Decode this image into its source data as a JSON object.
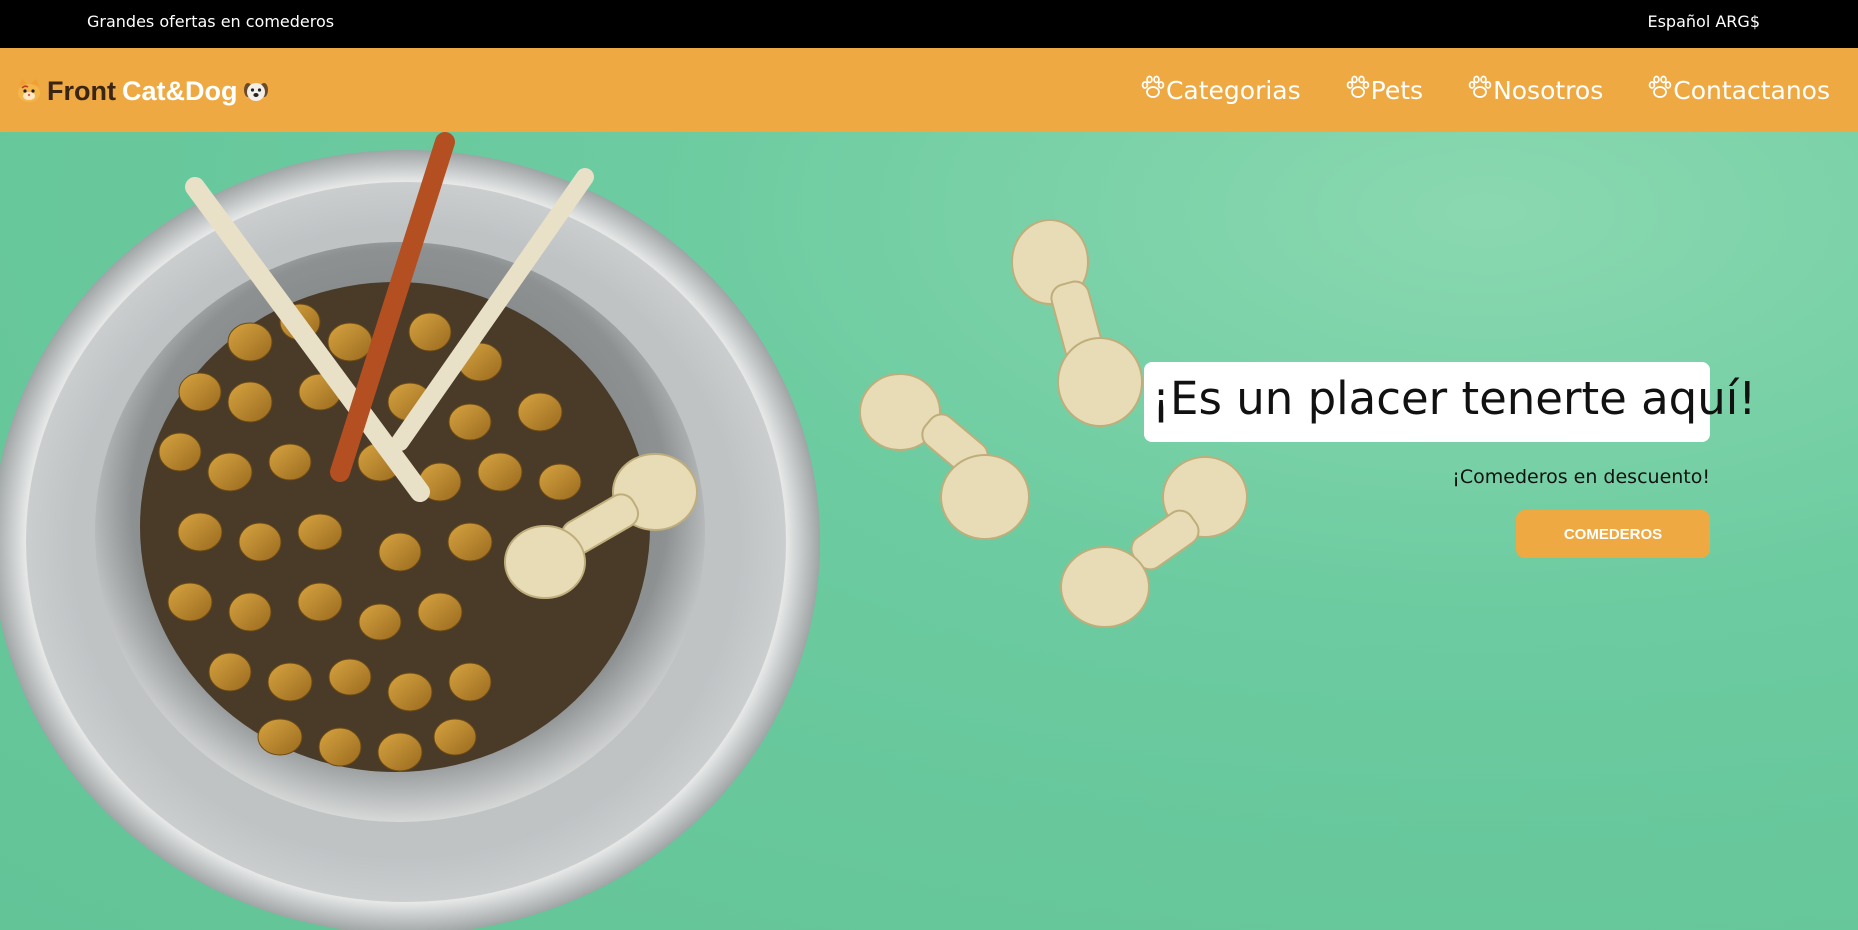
{
  "topbar": {
    "promo_text": "Grandes ofertas en comederos",
    "locale_text": "Español ARG$"
  },
  "brand": {
    "word1": "Front",
    "word2": "Cat&Dog",
    "left_icon": "cat-face-icon",
    "right_icon": "dog-face-icon"
  },
  "nav": {
    "items": [
      {
        "label": "Categorias",
        "icon": "paw-icon"
      },
      {
        "label": "Pets",
        "icon": "paw-icon"
      },
      {
        "label": "Nosotros",
        "icon": "paw-icon"
      },
      {
        "label": "Contactanos",
        "icon": "paw-icon"
      }
    ]
  },
  "hero": {
    "headline": "¡Es un placer tenerte aquí!",
    "subtitle": "¡Comederos en descuento!",
    "cta_label": "COMEDEROS",
    "image_description_icons": [
      "food-bowl-image",
      "rawhide-bone-image"
    ]
  },
  "colors": {
    "topbar_bg": "#000000",
    "navbar_bg": "#eea942",
    "hero_bg": "#6cc99e",
    "cta_bg": "#eea942",
    "brand_dark": "#3a2414",
    "headline_box_bg": "#ffffff"
  }
}
